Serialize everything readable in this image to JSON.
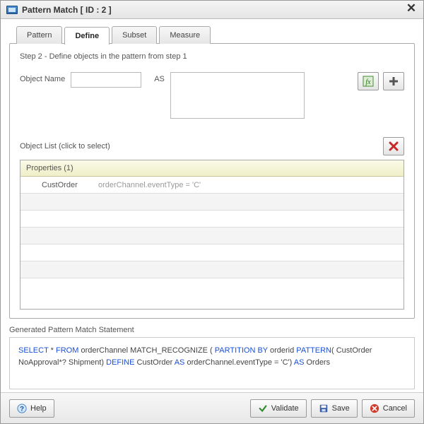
{
  "window": {
    "title": "Pattern Match [ ID : 2 ]"
  },
  "tabs": {
    "pattern": "Pattern",
    "define": "Define",
    "subset": "Subset",
    "measure": "Measure"
  },
  "step": {
    "label": "Step 2 - Define objects in the pattern from step 1"
  },
  "form": {
    "object_name_label": "Object Name",
    "object_name_value": "",
    "as_label": "AS",
    "as_value": ""
  },
  "object_list": {
    "header": "Object List (click to select)",
    "properties_header": "Properties (1)",
    "rows": [
      {
        "name": "CustOrder",
        "expr": "orderChannel.eventType = 'C'"
      }
    ]
  },
  "generated": {
    "label": "Generated Pattern Match Statement",
    "tokens": [
      {
        "t": "SELECT",
        "k": true
      },
      {
        "t": " * "
      },
      {
        "t": "FROM",
        "k": true
      },
      {
        "t": " orderChannel  MATCH_RECOGNIZE ( "
      },
      {
        "t": "PARTITION BY",
        "k": true
      },
      {
        "t": " orderid "
      },
      {
        "t": "PATTERN",
        "k": true
      },
      {
        "t": "( CustOrder NoApproval*? Shipment) "
      },
      {
        "t": "DEFINE",
        "k": true
      },
      {
        "t": " CustOrder "
      },
      {
        "t": "AS",
        "k": true
      },
      {
        "t": " orderChannel.eventType =  'C') "
      },
      {
        "t": "AS",
        "k": true
      },
      {
        "t": " Orders"
      }
    ]
  },
  "footer": {
    "help": "Help",
    "validate": "Validate",
    "save": "Save",
    "cancel": "Cancel"
  }
}
